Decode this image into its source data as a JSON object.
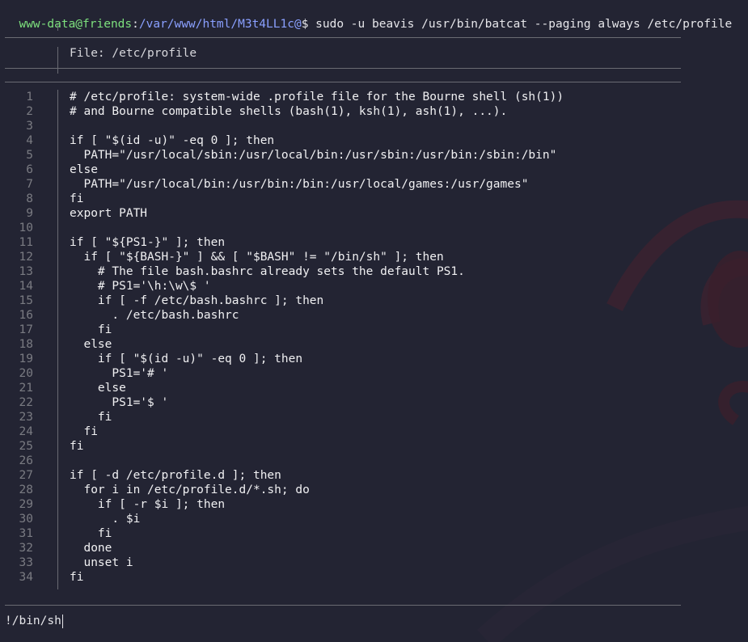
{
  "terminal": {
    "prompt_user_host": "www-data@friends",
    "prompt_sep": ":",
    "prompt_path": "/var/www/html/M3t4LL1c@",
    "prompt_symbol": "$",
    "command": " sudo -u beavis /usr/bin/batcat --paging always /etc/profile"
  },
  "pager": {
    "file_header": "File: /etc/profile",
    "lines": [
      {
        "n": "1",
        "text": "# /etc/profile: system-wide .profile file for the Bourne shell (sh(1))"
      },
      {
        "n": "2",
        "text": "# and Bourne compatible shells (bash(1), ksh(1), ash(1), ...)."
      },
      {
        "n": "3",
        "text": ""
      },
      {
        "n": "4",
        "text": "if [ \"$(id -u)\" -eq 0 ]; then"
      },
      {
        "n": "5",
        "text": "  PATH=\"/usr/local/sbin:/usr/local/bin:/usr/sbin:/usr/bin:/sbin:/bin\""
      },
      {
        "n": "6",
        "text": "else"
      },
      {
        "n": "7",
        "text": "  PATH=\"/usr/local/bin:/usr/bin:/bin:/usr/local/games:/usr/games\""
      },
      {
        "n": "8",
        "text": "fi"
      },
      {
        "n": "9",
        "text": "export PATH"
      },
      {
        "n": "10",
        "text": ""
      },
      {
        "n": "11",
        "text": "if [ \"${PS1-}\" ]; then"
      },
      {
        "n": "12",
        "text": "  if [ \"${BASH-}\" ] && [ \"$BASH\" != \"/bin/sh\" ]; then"
      },
      {
        "n": "13",
        "text": "    # The file bash.bashrc already sets the default PS1."
      },
      {
        "n": "14",
        "text": "    # PS1='\\h:\\w\\$ '"
      },
      {
        "n": "15",
        "text": "    if [ -f /etc/bash.bashrc ]; then"
      },
      {
        "n": "16",
        "text": "      . /etc/bash.bashrc"
      },
      {
        "n": "17",
        "text": "    fi"
      },
      {
        "n": "18",
        "text": "  else"
      },
      {
        "n": "19",
        "text": "    if [ \"$(id -u)\" -eq 0 ]; then"
      },
      {
        "n": "20",
        "text": "      PS1='# '"
      },
      {
        "n": "21",
        "text": "    else"
      },
      {
        "n": "22",
        "text": "      PS1='$ '"
      },
      {
        "n": "23",
        "text": "    fi"
      },
      {
        "n": "24",
        "text": "  fi"
      },
      {
        "n": "25",
        "text": "fi"
      },
      {
        "n": "26",
        "text": ""
      },
      {
        "n": "27",
        "text": "if [ -d /etc/profile.d ]; then"
      },
      {
        "n": "28",
        "text": "  for i in /etc/profile.d/*.sh; do"
      },
      {
        "n": "29",
        "text": "    if [ -r $i ]; then"
      },
      {
        "n": "30",
        "text": "      . $i"
      },
      {
        "n": "31",
        "text": "    fi"
      },
      {
        "n": "32",
        "text": "  done"
      },
      {
        "n": "33",
        "text": "  unset i"
      },
      {
        "n": "34",
        "text": "fi"
      }
    ],
    "input_value": "!/bin/sh"
  },
  "colors": {
    "background": "#232433",
    "prompt_user": "#7de07d",
    "prompt_path": "#8aa0ff",
    "rule": "#6a6b73",
    "line_number": "#7a7b82"
  }
}
